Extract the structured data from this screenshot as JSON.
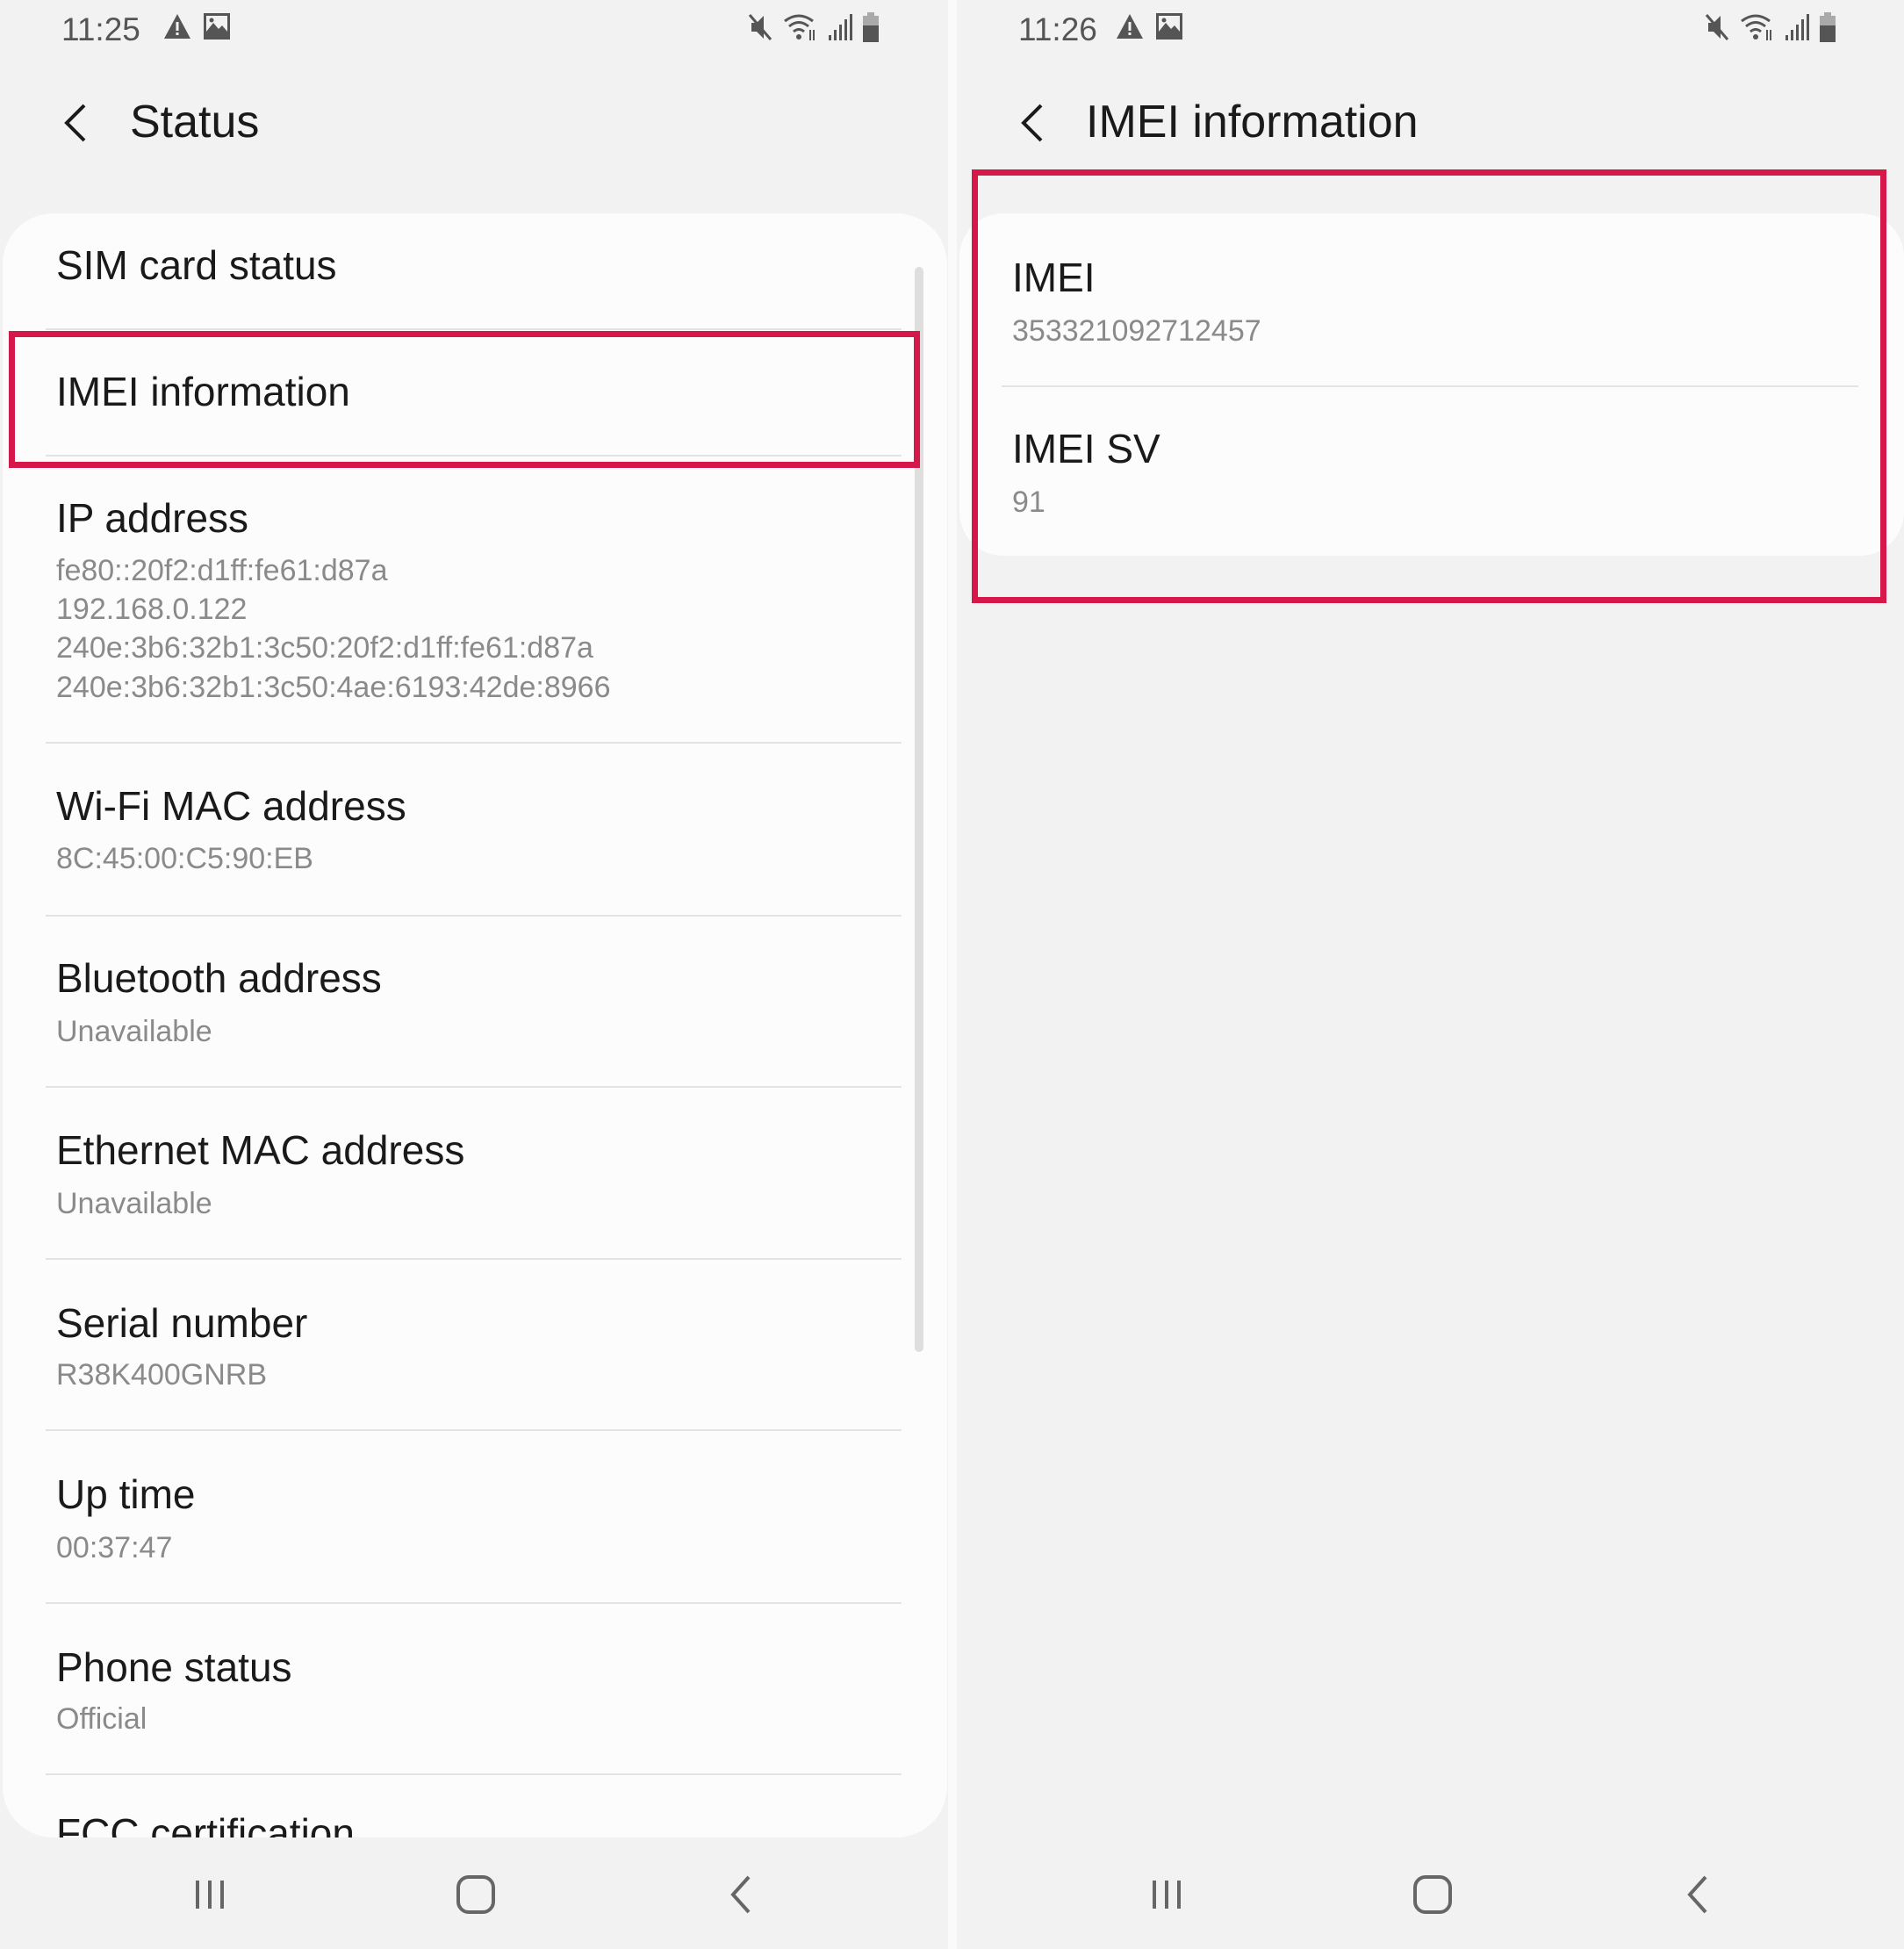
{
  "colors": {
    "highlight": "#d6174a",
    "background": "#f2f2f2",
    "card": "#fcfcfc"
  },
  "left": {
    "status_bar": {
      "time": "11:25",
      "icons": [
        "warning-icon",
        "image-icon",
        "mute-icon",
        "wifi-icon",
        "signal-icon",
        "battery-icon"
      ]
    },
    "header": {
      "title": "Status"
    },
    "items": [
      {
        "title": "SIM card status"
      },
      {
        "title": "IMEI information",
        "highlighted": true
      },
      {
        "title": "IP address",
        "subtitle_lines": [
          "fe80::20f2:d1ff:fe61:d87a",
          "192.168.0.122",
          "240e:3b6:32b1:3c50:20f2:d1ff:fe61:d87a",
          "240e:3b6:32b1:3c50:4ae:6193:42de:8966"
        ]
      },
      {
        "title": "Wi-Fi MAC address",
        "subtitle": "8C:45:00:C5:90:EB"
      },
      {
        "title": "Bluetooth address",
        "subtitle": "Unavailable"
      },
      {
        "title": "Ethernet MAC address",
        "subtitle": "Unavailable"
      },
      {
        "title": "Serial number",
        "subtitle": "R38K400GNRB"
      },
      {
        "title": "Up time",
        "subtitle": "00:37:47"
      },
      {
        "title": "Phone status",
        "subtitle": "Official"
      },
      {
        "title": "FCC certification"
      }
    ]
  },
  "right": {
    "status_bar": {
      "time": "11:26",
      "icons": [
        "warning-icon",
        "image-icon",
        "mute-icon",
        "wifi-icon",
        "signal-icon",
        "battery-icon"
      ]
    },
    "header": {
      "title": "IMEI information"
    },
    "items": [
      {
        "title": "IMEI",
        "subtitle": "353321092712457"
      },
      {
        "title": "IMEI SV",
        "subtitle": "91"
      }
    ]
  },
  "nav": {
    "buttons": [
      "recent-apps",
      "home",
      "back"
    ]
  }
}
